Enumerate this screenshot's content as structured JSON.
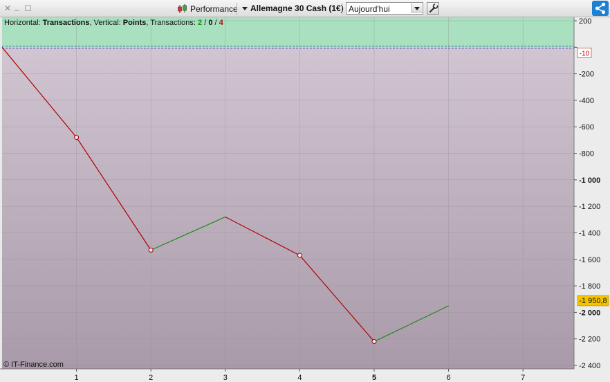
{
  "window_controls": {
    "close": "✕",
    "minimize": "_",
    "maximize": "☐"
  },
  "toolbar": {
    "performance_label": "Performance",
    "instrument_label": "Allemagne 30 Cash (1€)",
    "period": {
      "selected": "Aujourd'hui"
    }
  },
  "overlay": {
    "h_prefix": "Horizontal: ",
    "h_value": "Transactions",
    "v_prefix": ", Vertical: ",
    "v_value": "Points",
    "t_prefix": ", Transactions: ",
    "wins": "2",
    "sep1": " / ",
    "neutral": "0",
    "sep2": " / ",
    "losses": "4"
  },
  "credit": "© IT-Finance.com",
  "colors": {
    "win": "#1d8a1d",
    "loss": "#b00000",
    "accent": "#1f7fd0",
    "marker_current": "#f5c400"
  },
  "chart_data": {
    "type": "line",
    "x_label": "",
    "y_label": "",
    "x_ticks": [
      "1",
      "2",
      "3",
      "4",
      "5",
      "6",
      "7"
    ],
    "x_bold_tick": "5",
    "y_ticks": [
      "200",
      "-10",
      "-200",
      "-400",
      "-600",
      "-800",
      "-1 000",
      "-1 200",
      "-1 400",
      "-1 600",
      "-1 800",
      "-2 000",
      "-2 200",
      "-2 400"
    ],
    "y_tick_values": [
      200,
      0,
      -200,
      -400,
      -600,
      -800,
      -1000,
      -1200,
      -1400,
      -1600,
      -1800,
      -2000,
      -2200,
      -2400
    ],
    "ylim": [
      -2500,
      200
    ],
    "xlim": [
      0,
      7.7
    ],
    "points": [
      {
        "x": 0,
        "y": 0
      },
      {
        "x": 1,
        "y": -680
      },
      {
        "x": 2,
        "y": -1530
      },
      {
        "x": 3,
        "y": -1280
      },
      {
        "x": 4,
        "y": -1570
      },
      {
        "x": 5,
        "y": -2220
      },
      {
        "x": 6,
        "y": -1950.8
      }
    ],
    "segment_results": [
      "loss",
      "loss",
      "win",
      "loss",
      "loss",
      "win"
    ],
    "markers_at": [
      1,
      2,
      4,
      5
    ],
    "current_value_label": "-1 950,8",
    "current_value": -1950.8,
    "zero_line_label": "-10",
    "zero_line_value": -10,
    "grid": true,
    "positive_zone_color": "#a8e0c0",
    "plot_gradient": [
      "#d2c5d2",
      "#a89aa8"
    ]
  }
}
